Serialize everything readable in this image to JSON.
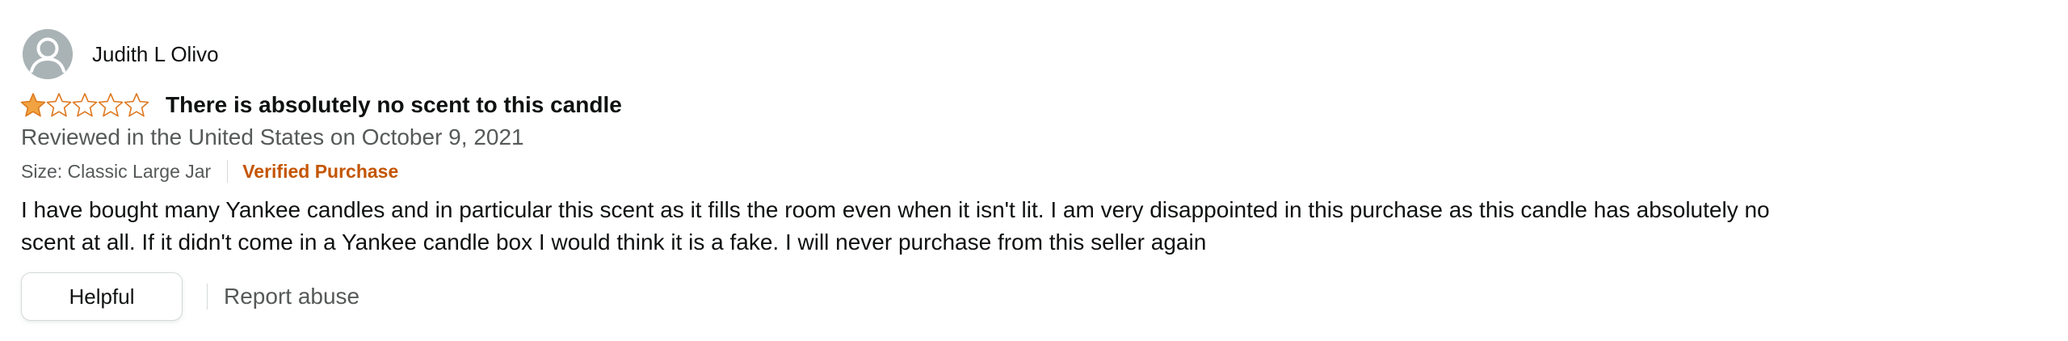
{
  "review": {
    "profile_name": "Judith L Olivo",
    "rating": 1,
    "rating_max": 5,
    "title": "There is absolutely no scent to this candle",
    "date_text": "Reviewed in the United States on October 9, 2021",
    "size_text": "Size: Classic Large Jar",
    "verified_label": "Verified Purchase",
    "body_text": "I have bought many Yankee candles and in particular this scent as it fills the room even when it isn't lit. I am very disappointed in this purchase as this candle has absolutely no scent at all. If it didn't come in a Yankee candle box I would think it is a fake. I will never purchase from this seller again",
    "helpful_label": "Helpful",
    "report_label": "Report abuse"
  },
  "colors": {
    "star_fill": "#f0a340",
    "star_stroke": "#de7921",
    "verified": "#c45500",
    "muted_text": "#565959",
    "avatar_bg": "#a9b3b6"
  },
  "icons": {
    "avatar": "default-user-icon",
    "star_filled": "star-filled-icon",
    "star_empty": "star-empty-icon"
  }
}
